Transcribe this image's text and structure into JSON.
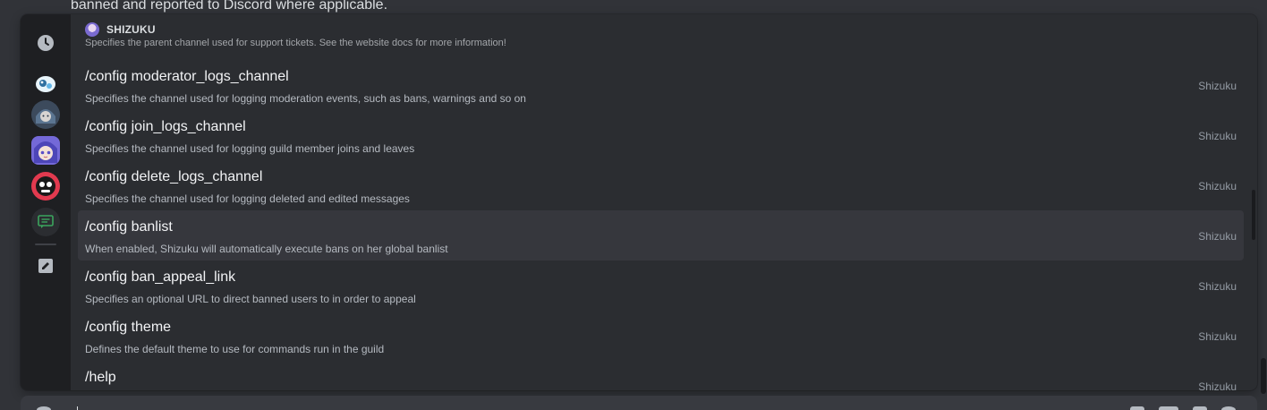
{
  "background": {
    "message_tail": "banned and reported to Discord where applicable."
  },
  "rail": {
    "items": [
      {
        "name": "recent-icon"
      },
      {
        "name": "app-avatar-1"
      },
      {
        "name": "app-avatar-2"
      },
      {
        "name": "app-avatar-shizuku"
      },
      {
        "name": "app-avatar-4"
      },
      {
        "name": "built-in-commands-icon"
      },
      {
        "name": "edit-icon"
      }
    ]
  },
  "section": {
    "title": "SHIZUKU",
    "cut_description": "Specifies the parent channel used for support tickets. See the website docs for more information!"
  },
  "commands": [
    {
      "name": "/config moderator_logs_channel",
      "description": "Specifies the channel used for logging moderation events, such as bans, warnings and so on",
      "source": "Shizuku"
    },
    {
      "name": "/config join_logs_channel",
      "description": "Specifies the channel used for logging guild member joins and leaves",
      "source": "Shizuku"
    },
    {
      "name": "/config delete_logs_channel",
      "description": "Specifies the channel used for logging deleted and edited messages",
      "source": "Shizuku"
    },
    {
      "name": "/config banlist",
      "description": "When enabled, Shizuku will automatically execute bans on her global banlist",
      "source": "Shizuku",
      "selected": true
    },
    {
      "name": "/config ban_appeal_link",
      "description": "Specifies an optional URL to direct banned users to in order to appeal",
      "source": "Shizuku"
    },
    {
      "name": "/config theme",
      "description": "Defines the default theme to use for commands run in the guild",
      "source": "Shizuku"
    },
    {
      "name": "/help",
      "description": "",
      "source": "Shizuku"
    }
  ],
  "colors": {
    "popup_bg": "#2b2d31",
    "rail_bg": "#1e1f22",
    "selected_row": "#36373d"
  }
}
